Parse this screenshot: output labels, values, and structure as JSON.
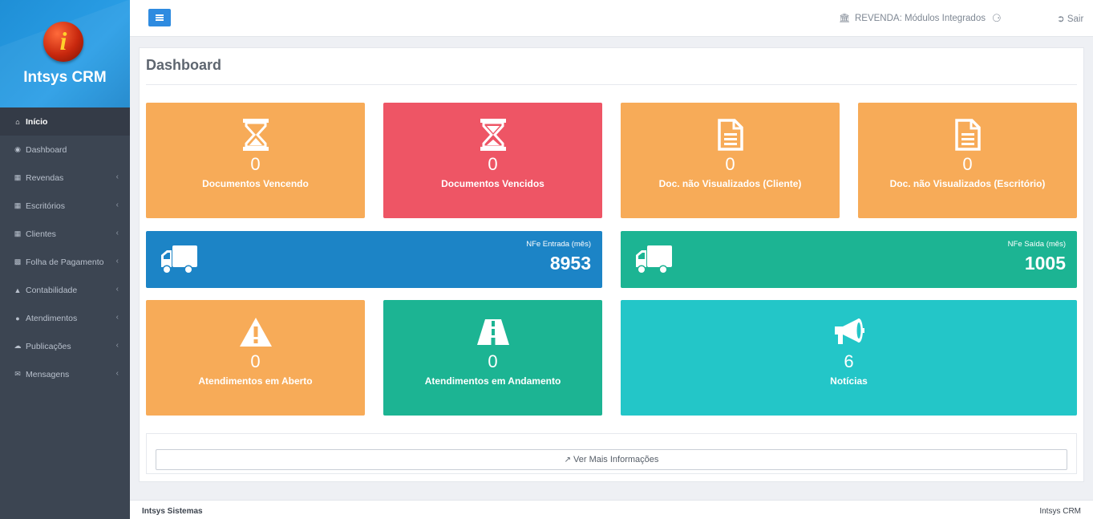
{
  "brand": {
    "name": "Intsys CRM",
    "logo_letter": "i"
  },
  "sidebar": {
    "items": [
      {
        "label": "Início",
        "icon": "home-icon",
        "active": true,
        "has_children": false
      },
      {
        "label": "Dashboard",
        "icon": "dashboard-icon",
        "active": false,
        "has_children": false
      },
      {
        "label": "Revendas",
        "icon": "building-icon",
        "active": false,
        "has_children": true
      },
      {
        "label": "Escritórios",
        "icon": "building-icon",
        "active": false,
        "has_children": true
      },
      {
        "label": "Clientes",
        "icon": "building-icon",
        "active": false,
        "has_children": true
      },
      {
        "label": "Folha de Pagamento",
        "icon": "money-icon",
        "active": false,
        "has_children": true
      },
      {
        "label": "Contabilidade",
        "icon": "bank-icon",
        "active": false,
        "has_children": true
      },
      {
        "label": "Atendimentos",
        "icon": "chat-icon",
        "active": false,
        "has_children": true
      },
      {
        "label": "Publicações",
        "icon": "cloud-icon",
        "active": false,
        "has_children": true
      },
      {
        "label": "Mensagens",
        "icon": "envelope-icon",
        "active": false,
        "has_children": true
      }
    ]
  },
  "topbar": {
    "revenda_label": "REVENDA: Módulos Integrados",
    "logout_label": "Sair"
  },
  "page": {
    "title": "Dashboard"
  },
  "cards_row1": [
    {
      "value": "0",
      "label": "Documentos Vencendo",
      "color": "#f7ab58",
      "icon": "hourglass-icon"
    },
    {
      "value": "0",
      "label": "Documentos Vencidos",
      "color": "#ee5565",
      "icon": "hourglass-icon"
    },
    {
      "value": "0",
      "label": "Doc. não Visualizados (Cliente)",
      "color": "#f7ab58",
      "icon": "document-icon"
    },
    {
      "value": "0",
      "label": "Doc. não Visualizados (Escritório)",
      "color": "#f7ab58",
      "icon": "document-icon"
    }
  ],
  "nfe": {
    "entrada": {
      "caption": "NFe Entrada (mês)",
      "value": "8953",
      "color": "#1c84c6"
    },
    "saida": {
      "caption": "NFe Saída (mês)",
      "value": "1005",
      "color": "#1cb493"
    }
  },
  "cards_row3": [
    {
      "value": "0",
      "label": "Atendimentos em Aberto",
      "color": "#f7ab58",
      "icon": "warning-icon"
    },
    {
      "value": "0",
      "label": "Atendimentos em Andamento",
      "color": "#1cb493",
      "icon": "road-icon"
    },
    {
      "value": "6",
      "label": "Notícias",
      "color": "#23c6c8",
      "icon": "bullhorn-icon"
    }
  ],
  "more_button": {
    "label": "Ver Mais Informações"
  },
  "footer": {
    "left": "Intsys Sistemas",
    "right": "Intsys CRM"
  }
}
